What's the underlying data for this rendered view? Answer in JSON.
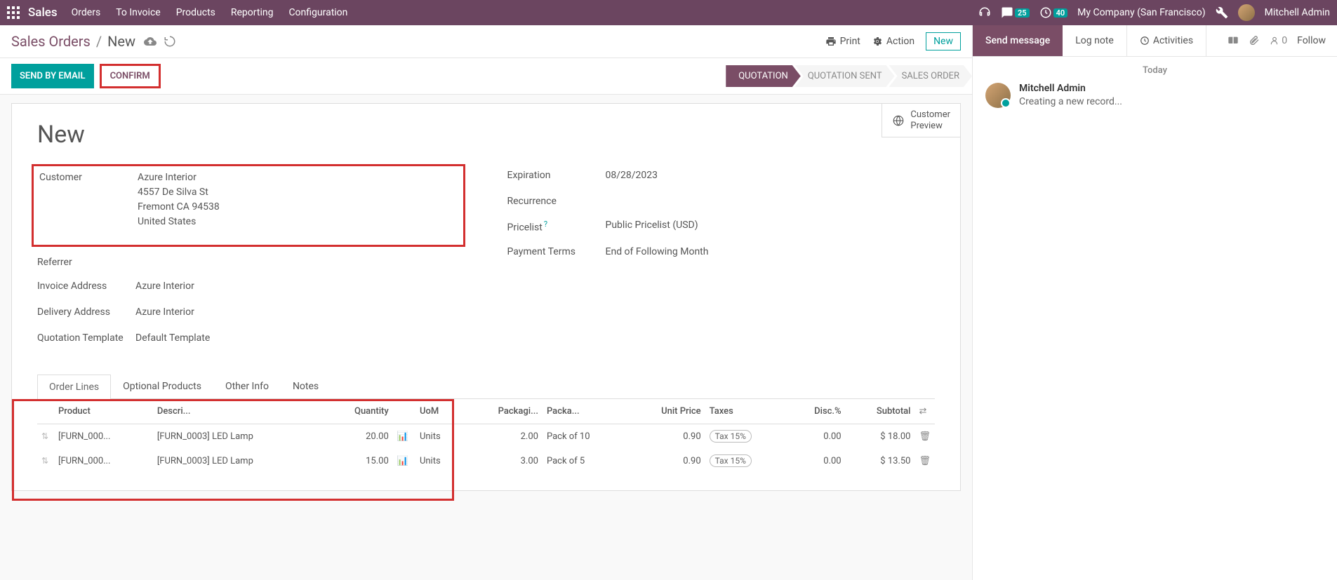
{
  "topbar": {
    "brand": "Sales",
    "menu": [
      "Orders",
      "To Invoice",
      "Products",
      "Reporting",
      "Configuration"
    ],
    "chat_badge": "25",
    "clock_badge": "40",
    "company": "My Company (San Francisco)",
    "username": "Mitchell Admin"
  },
  "breadcrumb": {
    "root": "Sales Orders",
    "current": "New",
    "print": "Print",
    "action": "Action",
    "new_btn": "New"
  },
  "status": {
    "send_email": "SEND BY EMAIL",
    "confirm": "CONFIRM",
    "steps": [
      "QUOTATION",
      "QUOTATION SENT",
      "SALES ORDER"
    ]
  },
  "sheet": {
    "preview_label": "Customer\nPreview",
    "title": "New",
    "fields_left": {
      "customer_label": "Customer",
      "customer_name": "Azure Interior",
      "customer_addr1": "4557 De Silva St",
      "customer_addr2": "Fremont CA 94538",
      "customer_country": "United States",
      "referrer_label": "Referrer",
      "invoice_addr_label": "Invoice Address",
      "invoice_addr_value": "Azure Interior",
      "delivery_addr_label": "Delivery Address",
      "delivery_addr_value": "Azure Interior",
      "template_label": "Quotation Template",
      "template_value": "Default Template"
    },
    "fields_right": {
      "expiration_label": "Expiration",
      "expiration_value": "08/28/2023",
      "recurrence_label": "Recurrence",
      "pricelist_label": "Pricelist",
      "pricelist_value": "Public Pricelist (USD)",
      "payment_label": "Payment Terms",
      "payment_value": "End of Following Month"
    }
  },
  "tabs": [
    "Order Lines",
    "Optional Products",
    "Other Info",
    "Notes"
  ],
  "table": {
    "headers": {
      "product": "Product",
      "descri": "Descri...",
      "quantity": "Quantity",
      "uom": "UoM",
      "packagi": "Packagi...",
      "packa": "Packa...",
      "unitprice": "Unit Price",
      "taxes": "Taxes",
      "disc": "Disc.%",
      "subtotal": "Subtotal"
    },
    "rows": [
      {
        "product": "[FURN_000...",
        "desc": "[FURN_0003] LED Lamp",
        "qty": "20.00",
        "uom": "Units",
        "pkqty": "2.00",
        "pkg": "Pack of 10",
        "price": "0.90",
        "tax": "Tax 15%",
        "disc": "0.00",
        "subtotal": "$ 18.00"
      },
      {
        "product": "[FURN_000...",
        "desc": "[FURN_0003] LED Lamp",
        "qty": "15.00",
        "uom": "Units",
        "pkqty": "3.00",
        "pkg": "Pack of 5",
        "price": "0.90",
        "tax": "Tax 15%",
        "disc": "0.00",
        "subtotal": "$ 13.50"
      }
    ]
  },
  "chatter": {
    "send": "Send message",
    "log": "Log note",
    "activities": "Activities",
    "follow": "Follow",
    "attach_count": "0",
    "today": "Today",
    "msg_author": "Mitchell Admin",
    "msg_text": "Creating a new record..."
  }
}
